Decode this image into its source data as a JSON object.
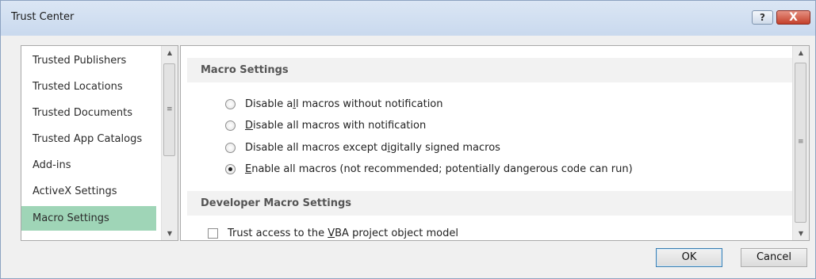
{
  "window": {
    "title": "Trust Center",
    "help_label": "?",
    "close_label": "X"
  },
  "nav": {
    "items": [
      {
        "label": "Trusted Publishers"
      },
      {
        "label": "Trusted Locations"
      },
      {
        "label": "Trusted Documents"
      },
      {
        "label": "Trusted App Catalogs"
      },
      {
        "label": "Add-ins"
      },
      {
        "label": "ActiveX Settings"
      },
      {
        "label": "Macro Settings",
        "selected": true
      }
    ]
  },
  "main": {
    "macro_header": "Macro Settings",
    "radios": [
      {
        "pre": "Disable a",
        "u": "l",
        "post": "l macros without notification",
        "checked": false
      },
      {
        "pre": "",
        "u": "D",
        "post": "isable all macros with notification",
        "checked": false
      },
      {
        "pre": "Disable all macros except d",
        "u": "i",
        "post": "gitally signed macros",
        "checked": false
      },
      {
        "pre": "",
        "u": "E",
        "post": "nable all macros (not recommended; potentially dangerous code can run)",
        "checked": true
      }
    ],
    "developer_header": "Developer Macro Settings",
    "trust_vba": {
      "pre": "Trust access to the ",
      "u": "V",
      "post": "BA project object model",
      "checked": false
    }
  },
  "footer": {
    "ok_label": "OK",
    "cancel_label": "Cancel"
  },
  "colors": {
    "selected_nav": "#9fd5b7",
    "titlebar": "#c9d9ee",
    "close_button": "#c4412b"
  }
}
